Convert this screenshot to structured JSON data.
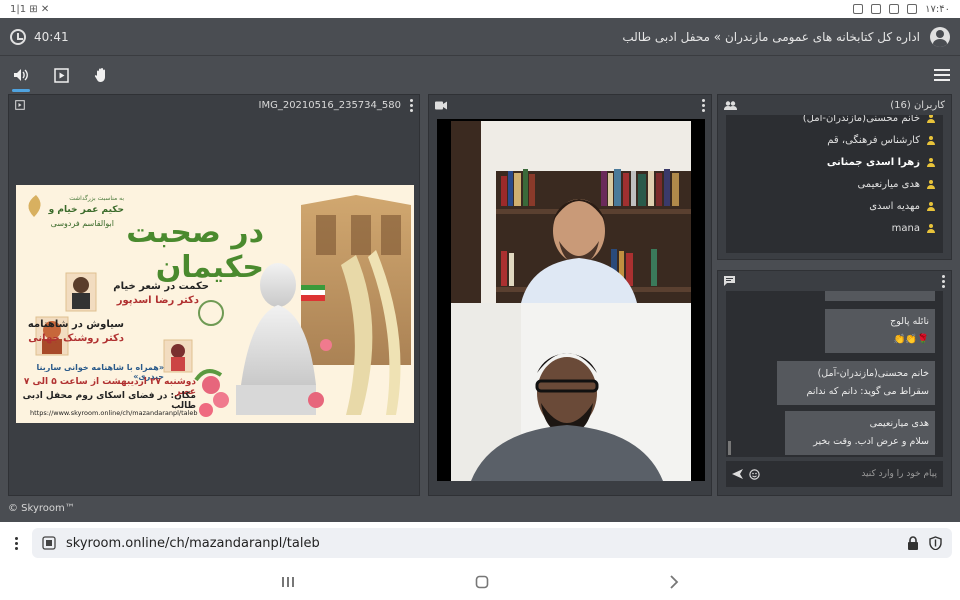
{
  "status_bar": {
    "time": "۱۷:۴۰",
    "left_icons_text": "1|1 ⊞ ✕"
  },
  "header": {
    "breadcrumb": "اداره کل کتابخانه های عمومی مازندران » محفل ادبی طالب",
    "timer": "40:41"
  },
  "document": {
    "title": "IMG_20210516_235734_580"
  },
  "poster": {
    "occasion_line": "به مناسبت بزرگداشت",
    "honorees_1": "حکیم عمر خیام و",
    "honorees_2": "ابوالقاسم فردوسی",
    "main_title": "در صحبت حکیمان",
    "talk1_title": "حکمت در شعر خیام",
    "talk1_speaker": "دکتر رضا اسدپور",
    "talk2_title": "سیاوش در شاهنامه",
    "talk2_speaker": "دکتر روشنک جهانی",
    "reading": "«همراه با شاهنامه خوانی ساربنا حیدری»",
    "date_line": "دوشنبه ۲۷ اردیبهشت از ساعت ۵ الی ۷ عصر",
    "place_line": "مکان: در فضای اسکای روم محفل ادبی طالب",
    "url": "https://www.skyroom.online/ch/mazandaranpl/taleb"
  },
  "users": {
    "header": "کاربران (16)",
    "list": [
      {
        "name": "خانم محسنی(مازندران-آمل)",
        "bold": false
      },
      {
        "name": "کارشناس فرهنگی، قم",
        "bold": false
      },
      {
        "name": "زهرا اسدی جمنانی",
        "bold": true
      },
      {
        "name": "هدی میارنعیمی",
        "bold": false
      },
      {
        "name": "مهدیه اسدی",
        "bold": false
      },
      {
        "name": "mana",
        "bold": false
      }
    ]
  },
  "chat": {
    "messages": [
      {
        "sender": "نائله پالوج",
        "text": "🌹👏👏"
      },
      {
        "sender": "خانم محسنی(مازندران-آمل)",
        "text": "سقراط می گوید: دانم که ندانم"
      },
      {
        "sender": "هدی میارنعیمی",
        "text": "سلام و عرض ادب. وقت بخیر"
      }
    ],
    "input_placeholder": "پیام خود را وارد کنید"
  },
  "footer": {
    "brand": "© Skyroom™"
  },
  "browser": {
    "url": "skyroom.online/ch/mazandaranpl/taleb"
  },
  "colors": {
    "accent": "#4fa3e0",
    "bg": "#4a4d52",
    "panel": "#3b3e43",
    "user_icon": "#e8c33a"
  }
}
